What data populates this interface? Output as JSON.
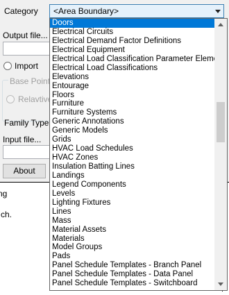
{
  "dialog": {
    "category_label": "Category",
    "category_value": "<Area Boundary>",
    "output_file_label": "Output file...",
    "output_file_value": "",
    "import_label": "Import",
    "base_point_label": "Base Point",
    "relative_label": "Relavtive",
    "family_type_label": "Family Type",
    "input_file_label": "Input file...",
    "input_file_value": "",
    "about_button": "About"
  },
  "background": {
    "text_1": "ng",
    "text_2": "ch."
  },
  "dropdown": {
    "selected_index": 0,
    "items": [
      "Doors",
      "Electrical Circuits",
      "Electrical Demand Factor Definitions",
      "Electrical Equipment",
      "Electrical Load Classification Parameter Element",
      "Electrical Load Classifications",
      "Elevations",
      "Entourage",
      "Floors",
      "Furniture",
      "Furniture Systems",
      "Generic Annotations",
      "Generic Models",
      "Grids",
      "HVAC Load Schedules",
      "HVAC Zones",
      "Insulation Batting Lines",
      "Landings",
      "Legend Components",
      "Levels",
      "Lighting Fixtures",
      "Lines",
      "Mass",
      "Material Assets",
      "Materials",
      "Model Groups",
      "Pads",
      "Panel Schedule Templates - Branch Panel",
      "Panel Schedule Templates - Data Panel",
      "Panel Schedule Templates - Switchboard"
    ]
  }
}
